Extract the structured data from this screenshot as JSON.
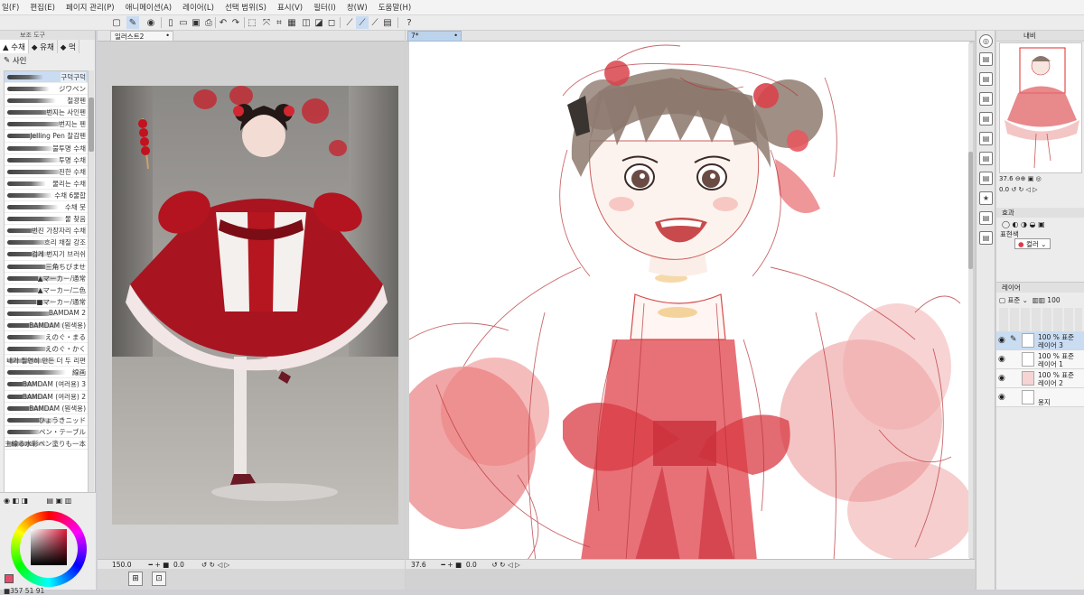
{
  "menu": [
    "일(F)",
    "편집(E)",
    "페이지 관리(P)",
    "애니메이션(A)",
    "레이어(L)",
    "선택 범위(S)",
    "표시(V)",
    "필터(I)",
    "창(W)",
    "도움말(H)"
  ],
  "tool_panel": {
    "header": "보조 도구",
    "tabs": [
      "수채",
      "유채",
      "먹"
    ],
    "subtab": "사인",
    "brushes": [
      "구덕구덕",
      "ジワベン",
      "철광펜",
      "번지는 사인펜",
      "번지는 펜",
      "Jelling Pen 찰감펜",
      "불투명 수채",
      "투명 수채",
      "진한 수채",
      "물리는 수채",
      "수채 6물합",
      "수채 붓",
      "물 찾음",
      "번진 가장자리 수채",
      "흐리 채질 강조",
      "검게 번지기 브러쉬",
      "三角ちびませ",
      "▲マーカー/通常",
      "▲マーカー/二色",
      "■マーカー/通常",
      "BAMDAM 2",
      "BAMDAM (뭔색용)",
      "えのぐ・まる",
      "えのぐ・かく",
      "내가 필연히 만든 더 두 리편",
      "線画",
      "BAMDAM (여러용) 3",
      "BAMDAM (여러용) 2",
      "BAMDAM (뭔색용)",
      "ひょうきニッド",
      "ペン・テーブル",
      "主線る水彩ペン塗りも一本"
    ],
    "color_values": "357 51 91"
  },
  "reference": {
    "tab_label": "일러스트2",
    "zoom": "150.0",
    "angle": "0.0"
  },
  "canvas": {
    "tab_label": "7*",
    "zoom": "37.6",
    "angle": "0.0"
  },
  "navigator": {
    "title": "내비",
    "zoom": "37.6",
    "angle": "0.0"
  },
  "effects": {
    "title": "효과",
    "color_label": "표현색",
    "color_value": "컬러"
  },
  "layers": {
    "title": "레이어",
    "blend_mode": "표준",
    "opacity": "100",
    "items": [
      {
        "name_line1": "100 % 표준",
        "name_line2": "레이어 3"
      },
      {
        "name_line1": "100 % 표준",
        "name_line2": "레이어 1"
      },
      {
        "name_line1": "100 % 표준",
        "name_line2": "레이어 2"
      },
      {
        "name_line1": "",
        "name_line2": "용지"
      }
    ]
  },
  "colors": {
    "accent": "#c9dcf2",
    "main_color": "#e24d6e",
    "drawing_red": "#e03a4a"
  }
}
